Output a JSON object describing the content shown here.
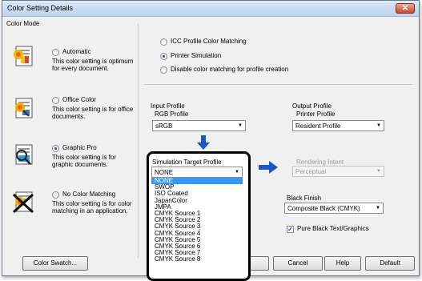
{
  "window": {
    "title": "Color Setting Details",
    "close_glyph": "✕"
  },
  "color_mode": {
    "heading": "Color Mode",
    "modes": [
      {
        "name": "Automatic",
        "desc1": "This color setting is optimum",
        "desc2": "for every document.",
        "selected": false,
        "icon": "automatic-color-icon"
      },
      {
        "name": "Office Color",
        "desc1": "This color setting is for office",
        "desc2": "documents.",
        "selected": false,
        "icon": "office-color-icon"
      },
      {
        "name": "Graphic Pro",
        "desc1": "This color setting is for",
        "desc2": "graphic documents.",
        "selected": true,
        "icon": "graphic-pro-icon"
      },
      {
        "name": "No Color Matching",
        "desc1": "This color setting is for color",
        "desc2": "matching in an application.",
        "selected": false,
        "icon": "no-color-matching-icon"
      }
    ]
  },
  "matching": {
    "options": [
      {
        "label": "ICC Profile Color Matching",
        "selected": false
      },
      {
        "label": "Printer Simulation",
        "selected": true
      },
      {
        "label": "Disable color matching for profile creation",
        "selected": false
      }
    ]
  },
  "input_profile": {
    "heading": "Input Profile",
    "rgb_label": "RGB Profile",
    "rgb_value": "sRGB"
  },
  "output_profile": {
    "heading": "Output Profile",
    "printer_label": "Printer Profile",
    "printer_value": "Resident Profile",
    "intent_label": "Rendering Intent",
    "intent_value": "Perceptual"
  },
  "simulation": {
    "label": "Simulation Target Profile",
    "value": "NONE",
    "options": [
      "NONE",
      "SWOP",
      "ISO Coated",
      "JapanColor",
      "JMPA",
      "CMYK Source 1",
      "CMYK Source 2",
      "CMYK Source 3",
      "CMYK Source 4",
      "CMYK Source 5",
      "CMYK Source 6",
      "CMYK Source 7",
      "CMYK Source 8"
    ],
    "highlighted_index": 0
  },
  "black_finish": {
    "label": "Black Finish",
    "value": "Composite Black (CMYK)"
  },
  "pure_black": {
    "label": "Pure Black Text/Graphics",
    "checked": true,
    "check_glyph": "✓"
  },
  "buttons": {
    "color_swatch": "Color Swatch...",
    "cancel": "Cancel",
    "help": "Help",
    "default": "Default"
  },
  "colors": {
    "accent": "#1f4fa3",
    "selection": "#3399ff",
    "arrow": "#1e56c8"
  }
}
